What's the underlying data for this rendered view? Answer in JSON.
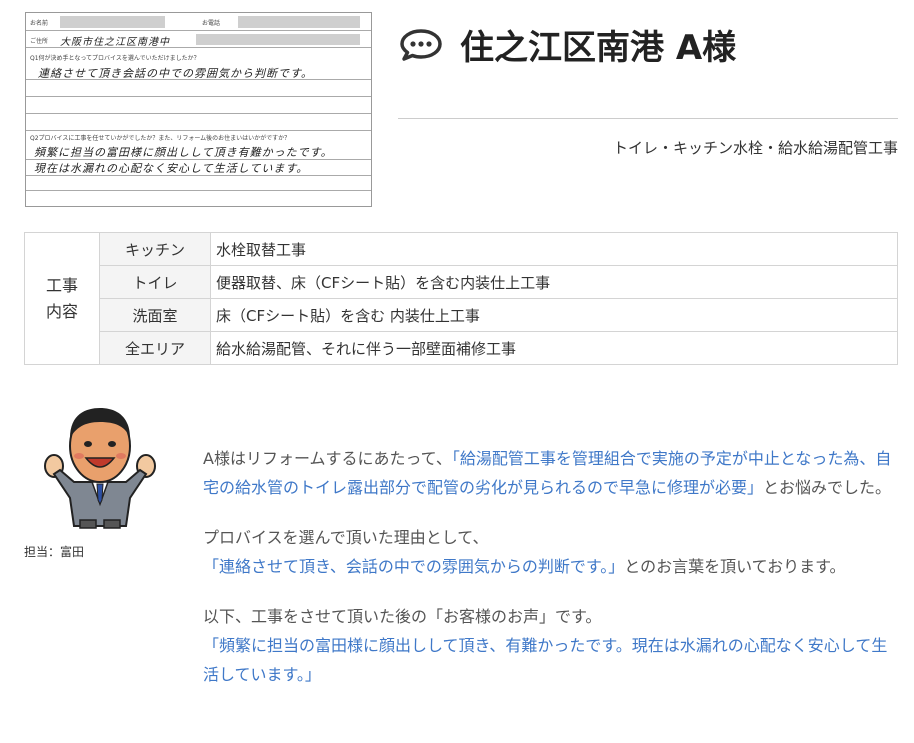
{
  "title": "住之江区南港 A様",
  "subtitle": "トイレ・キッチン水栓・給水給湯配管工事",
  "survey": {
    "name_label": "お名前",
    "phone_label": "お電話",
    "address_label": "ご住所",
    "address_value": "大阪市住之江区南港中",
    "q1": "Q1何が決め手となってプロバイスを選んでいただけましたか？",
    "a1": "連絡させて頂き会話の中での雰囲気から判断です。",
    "q2": "Q2プロバイスに工事を任せていかがでしたか？また、リフォーム後のお住まいはいかがですか？",
    "a2_line1": "頻繁に担当の富田様に顔出しして頂き有難かったです。",
    "a2_line2": "現在は水漏れの心配なく安心して生活しています。"
  },
  "work": {
    "heading": "工事内容",
    "heading_line1": "工事",
    "heading_line2": "内容",
    "rows": [
      {
        "area": "キッチン",
        "desc": "水栓取替工事"
      },
      {
        "area": "トイレ",
        "desc": "便器取替、床（CFシート貼）を含む内装仕上工事"
      },
      {
        "area": "洗面室",
        "desc": "床（CFシート貼）を含む 内装仕上工事"
      },
      {
        "area": "全エリア",
        "desc": "給水給湯配管、それに伴う一部壁面補修工事"
      }
    ]
  },
  "staff_label": "担当：富田",
  "body": {
    "p1_pre": "A様はリフォームするにあたって、",
    "p1_quote": "「給湯配管工事を管理組合で実施の予定が中止となった為、自宅の給水管のトイレ露出部分で配管の劣化が見られるので早急に修理が必要」",
    "p1_post": "とお悩みでした。",
    "p2_pre": "プロバイスを選んで頂いた理由として、",
    "p2_quote": "「連絡させて頂き、会話の中での雰囲気からの判断です。」",
    "p2_post": "とのお言葉を頂いております。",
    "p3_intro": "以下、工事をさせて頂いた後の「お客様のお声」です。",
    "p3_quote": "「頻繁に担当の富田様に顔出しして頂き、有難かったです。現在は水漏れの心配なく安心して生活しています。」"
  },
  "colors": {
    "accent_blue": "#3f78c8",
    "text": "#555555"
  },
  "icons": {
    "title": "speech-bubble-icon"
  }
}
